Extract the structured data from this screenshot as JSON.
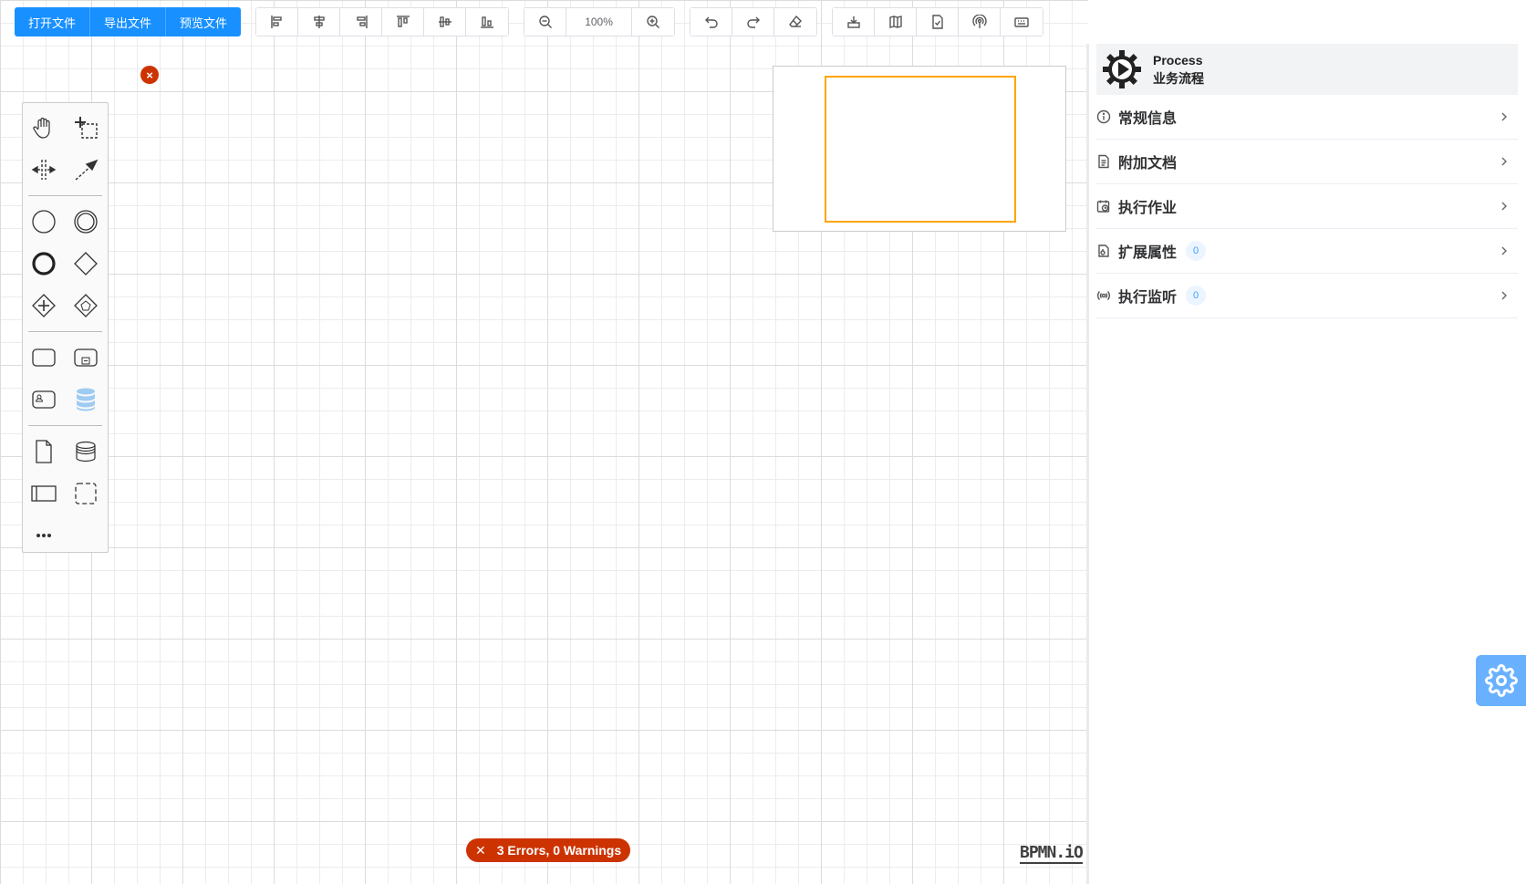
{
  "toolbar": {
    "file_buttons": [
      "打开文件",
      "导出文件",
      "预览文件"
    ],
    "zoom_level": "100%"
  },
  "panel": {
    "header_title": "Process",
    "header_subtitle": "业务流程",
    "sections": [
      {
        "label": "常规信息",
        "icon": "info-icon"
      },
      {
        "label": "附加文档",
        "icon": "document-icon"
      },
      {
        "label": "执行作业",
        "icon": "calendar-clock-icon"
      },
      {
        "label": "扩展属性",
        "icon": "extension-icon",
        "badge": "0"
      },
      {
        "label": "执行监听",
        "icon": "broadcast-icon",
        "badge": "0"
      }
    ]
  },
  "lint": {
    "label": "3 Errors, 0 Warnings"
  },
  "logo": {
    "text": "BPMN.iO"
  },
  "colors": {
    "primary": "#1890ff",
    "error": "#cc3300",
    "minimap_viewport": "#ffa500",
    "fab": "#69b1ff"
  }
}
